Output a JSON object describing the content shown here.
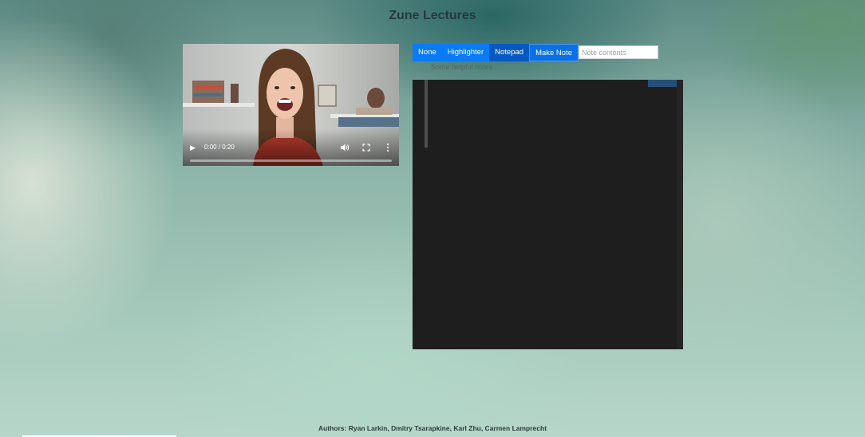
{
  "page": {
    "title": "Zune Lectures"
  },
  "video": {
    "time": "0:00 / 0:20",
    "progress_fraction": 0.0
  },
  "toolbar": {
    "modes": [
      "None",
      "Highlighter",
      "Notepad"
    ],
    "active_mode": "Notepad",
    "make_note_label": "Make Note",
    "note_input": {
      "value": "",
      "placeholder": "Note contents"
    }
  },
  "notes": {
    "helper_text": "Some helpful notes"
  },
  "footer": {
    "credits": "Authors: Ryan Larkin, Dmitry Tsarapkine, Karl Zhu, Carmen Lamprecht"
  },
  "colors": {
    "button_blue": "#0a7bf5",
    "button_active": "#0759c2",
    "editor_background": "#1e1e1e"
  },
  "icons": [
    "play-icon",
    "volume-icon",
    "fullscreen-icon",
    "more-options-icon"
  ]
}
